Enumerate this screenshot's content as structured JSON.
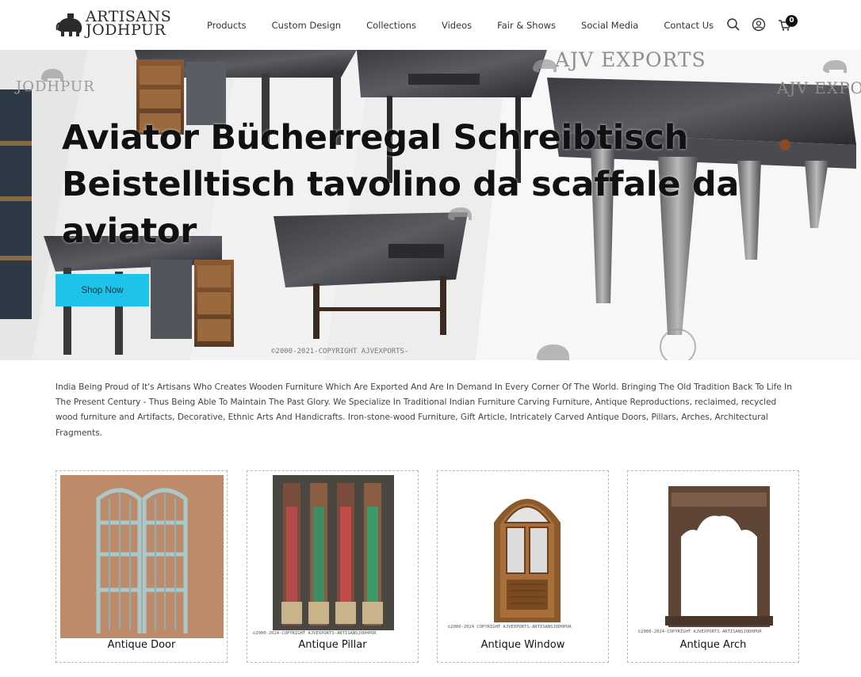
{
  "brand": {
    "line1": "ARTISANS",
    "line2": "JODHPUR",
    "logo_icon": "elephant-icon"
  },
  "nav": {
    "items": [
      "Products",
      "Custom Design",
      "Collections",
      "Videos",
      "Fair & Shows",
      "Social Media",
      "Contact Us"
    ],
    "icons": [
      "search-icon",
      "user-icon",
      "cart-icon"
    ],
    "cart_count": "0"
  },
  "hero": {
    "title": "Aviator Bücherregal Schreibtisch Beistelltisch tavolino da scaffale da aviator",
    "cta": "Shop Now",
    "watermarks": [
      "AJV EXPORTS",
      "JODHPUR",
      "AJV EXPORTS",
      "©2000-2021-COPYRIGHT AJVEXPORTS-"
    ]
  },
  "intro": "India Being Proud of It's Artisans Who Creates Wooden Furniture Which Are Exported And Are In Demand In Every Corner Of The World. Bringing The Old Tradition Back To Life In The Present Century - Thus Being Able To Maintain The Past Glory. We Specialize In Traditional Indian Furniture Carving Furniture, Antique Reproductions, reclaimed, recycled wood furniture and Artifacts, Decorative, Ethnic Arts And Handicrafts. Iron-stone-wood Furniture, Gift Article, Intricately Carved Antique Doors, Pillars, Arches, Architectural Fragments.",
  "categories": [
    {
      "label": "Antique Door",
      "watermark": ""
    },
    {
      "label": "Antique Pillar",
      "watermark": "©2000-2024-COPYRIGHT AJVEXPORTS-ARTISANSJODHPUR"
    },
    {
      "label": "Antique Window",
      "watermark": "©2000-2024 COPYRIGHT AJVEXPORTS-ARTISANSJODHPUR"
    },
    {
      "label": "Antique Arch",
      "watermark": "©2000-2024-COPYRIGHT AJVEXPORTS-ARTISANSJODHPUR"
    }
  ],
  "colors": {
    "accent": "#1ec3ea",
    "text": "#222222",
    "border": "#b8b8b8"
  }
}
